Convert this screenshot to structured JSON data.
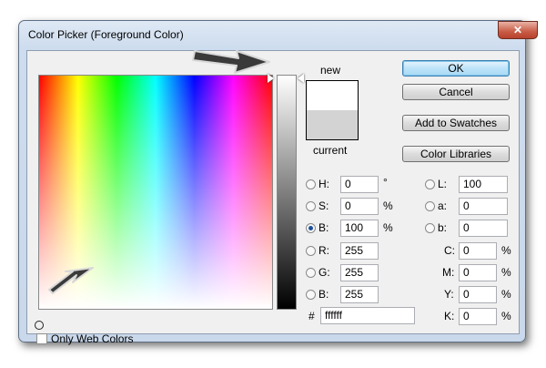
{
  "window": {
    "title": "Color Picker (Foreground Color)",
    "close_glyph": "✕"
  },
  "swatch": {
    "new_label": "new",
    "current_label": "current",
    "new_color": "#ffffff",
    "current_color": "#d3d3d3"
  },
  "buttons": {
    "ok": "OK",
    "cancel": "Cancel",
    "add_to_swatches": "Add to Swatches",
    "color_libraries": "Color Libraries"
  },
  "hsb": {
    "h": {
      "label": "H:",
      "value": "0",
      "unit": "°"
    },
    "s": {
      "label": "S:",
      "value": "0",
      "unit": "%"
    },
    "b": {
      "label": "B:",
      "value": "100",
      "unit": "%",
      "selected": true
    }
  },
  "rgb": {
    "r": {
      "label": "R:",
      "value": "255"
    },
    "g": {
      "label": "G:",
      "value": "255"
    },
    "b": {
      "label": "B:",
      "value": "255"
    }
  },
  "lab": {
    "l": {
      "label": "L:",
      "value": "100"
    },
    "a": {
      "label": "a:",
      "value": "0"
    },
    "b": {
      "label": "b:",
      "value": "0"
    }
  },
  "cmyk": {
    "c": {
      "label": "C:",
      "value": "0",
      "unit": "%"
    },
    "m": {
      "label": "M:",
      "value": "0",
      "unit": "%"
    },
    "y": {
      "label": "Y:",
      "value": "0",
      "unit": "%"
    },
    "k": {
      "label": "K:",
      "value": "0",
      "unit": "%"
    }
  },
  "hex": {
    "label": "#",
    "value": "ffffff"
  },
  "web_colors": {
    "label": "Only Web Colors",
    "checked": false
  },
  "colors": {
    "accent_button": "#bde3f9",
    "frame": "#cddcee",
    "hue_start": "#ff0000"
  }
}
